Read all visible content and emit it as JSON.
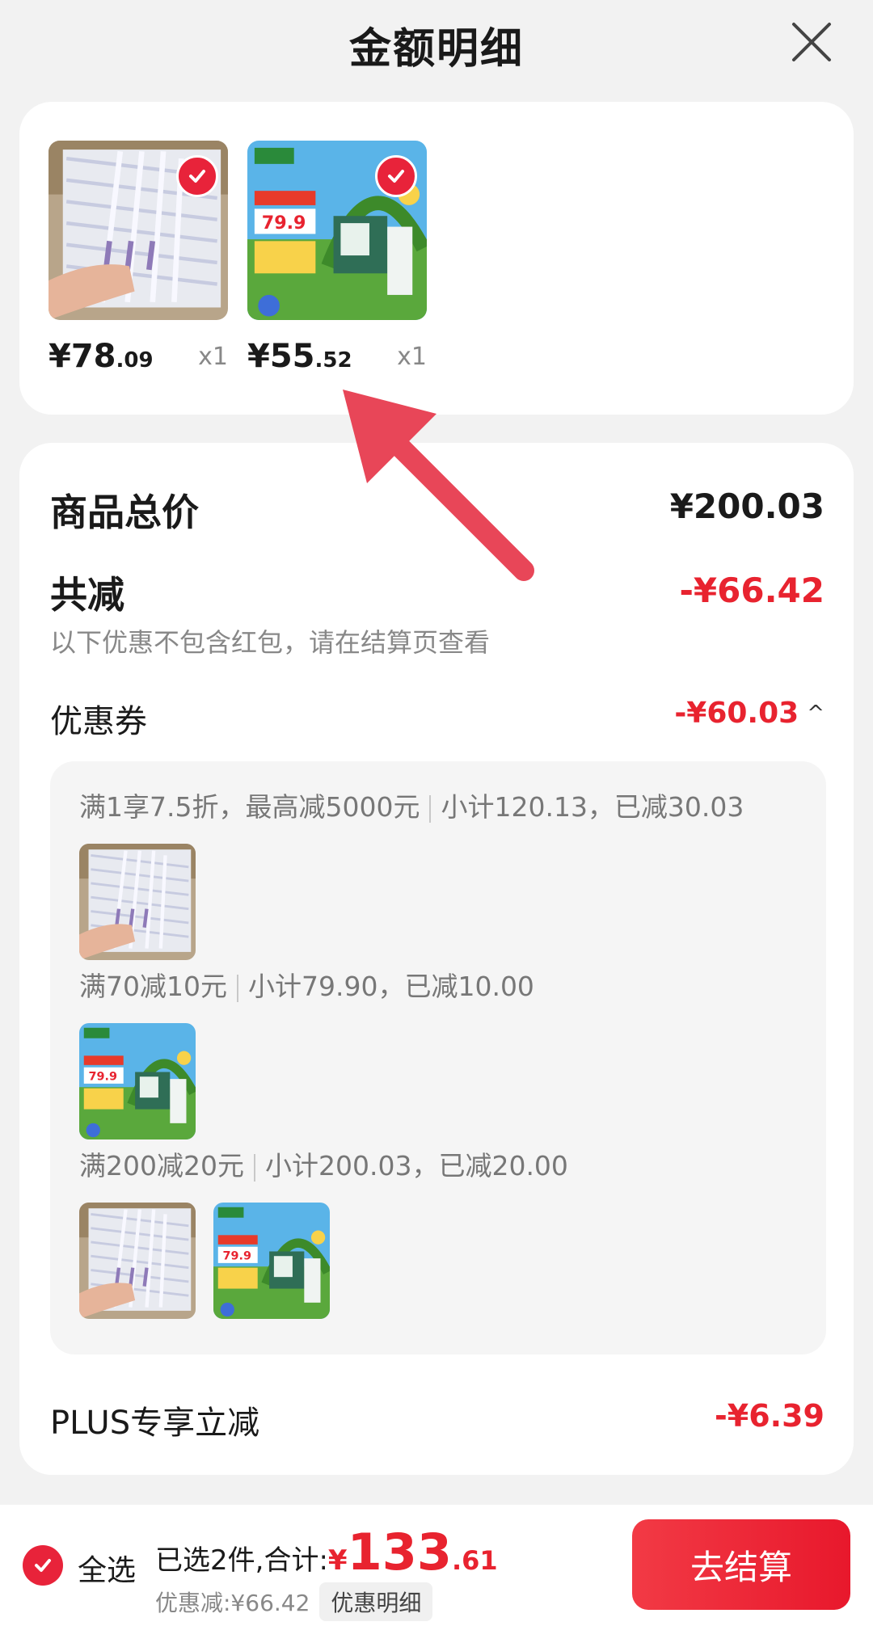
{
  "header": {
    "title": "金额明细",
    "close_icon": "close-icon"
  },
  "products": [
    {
      "price_main": "¥78",
      "price_cents": ".09",
      "qty": "x1",
      "image": "straws-product-image",
      "selected": true
    },
    {
      "price_main": "¥55",
      "price_cents": ".52",
      "qty": "x1",
      "image": "milk-product-image",
      "selected": true
    }
  ],
  "summary": {
    "goods_total_label": "商品总价",
    "goods_total_value": "¥200.03",
    "reduce_label": "共减",
    "reduce_value": "-¥66.42",
    "reduce_note": "以下优惠不包含红包，请在结算页查看",
    "coupon_label": "优惠券",
    "coupon_value": "-¥60.03",
    "coupon_caret": "^",
    "coupons": [
      {
        "rule": "满1享7.5折，最高减5000元",
        "detail": "小计120.13，已减30.03"
      },
      {
        "rule": "满70减10元",
        "detail": "小计79.90，已减10.00"
      },
      {
        "rule": "满200减20元",
        "detail": "小计200.03，已减20.00"
      }
    ],
    "plus_label": "PLUS专享立减",
    "plus_value": "-¥6.39"
  },
  "bottom": {
    "select_all": "全选",
    "selected_text": "已选2件,合计:",
    "total_symbol": "¥",
    "total_main": "133",
    "total_cents": ".61",
    "discount_text": "优惠减:¥66.42",
    "detail_button": "优惠明细",
    "checkout_button": "去结算"
  },
  "colors": {
    "accent": "#e8232f",
    "background": "#f2f2f2"
  }
}
